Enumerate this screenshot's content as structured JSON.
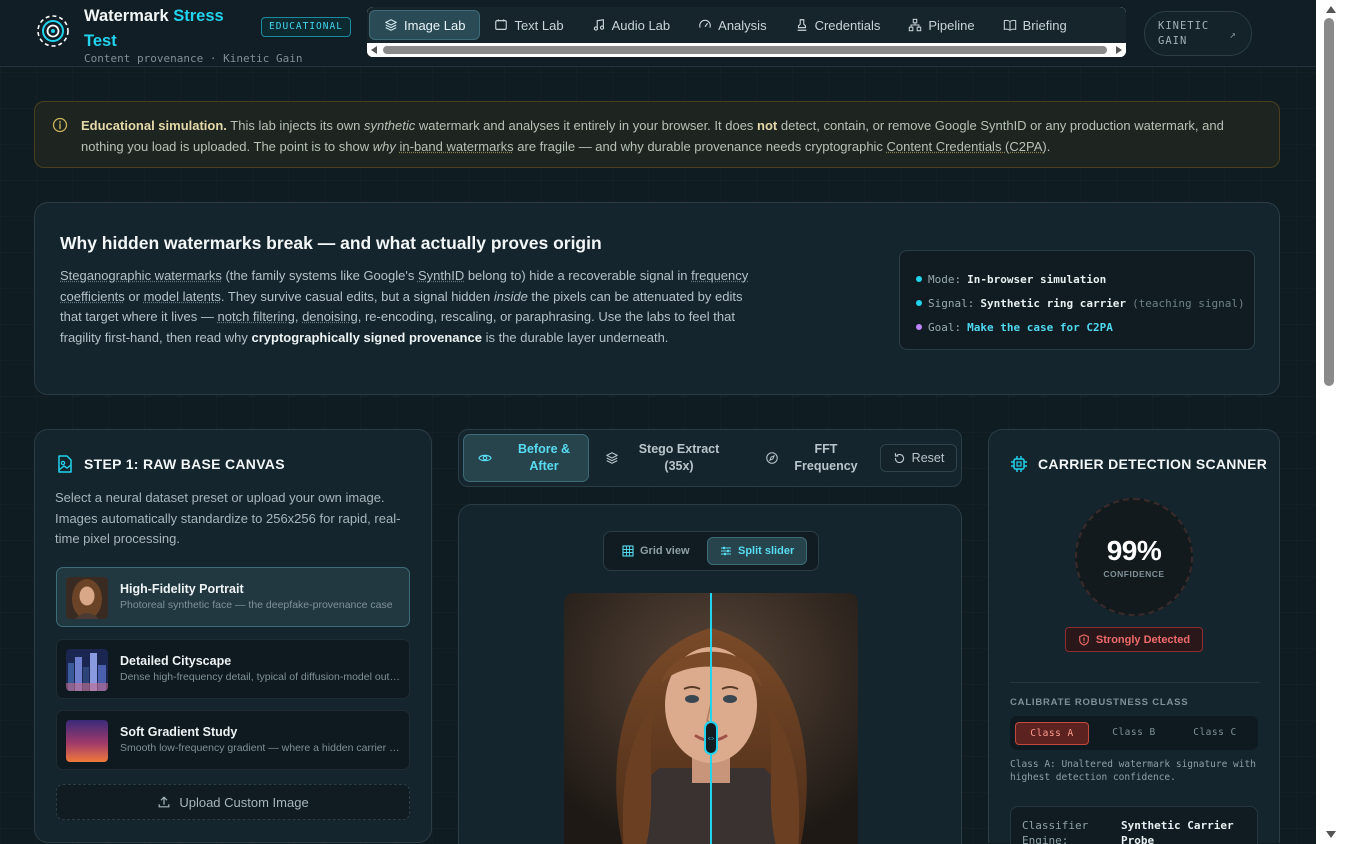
{
  "header": {
    "brand_title_main": "Watermark ",
    "brand_title_accent": "Stress Test",
    "brand_subtitle": "Content provenance · Kinetic Gain",
    "badge": "EDUCATIONAL",
    "nav_tabs": [
      {
        "label": "Image Lab",
        "icon": "image-layers-icon",
        "active": true
      },
      {
        "label": "Text Lab",
        "icon": "text-icon",
        "active": false
      },
      {
        "label": "Audio Lab",
        "icon": "music-note-icon",
        "active": false
      },
      {
        "label": "Analysis",
        "icon": "gauge-icon",
        "active": false
      },
      {
        "label": "Credentials",
        "icon": "stamp-icon",
        "active": false
      },
      {
        "label": "Pipeline",
        "icon": "network-icon",
        "active": false
      },
      {
        "label": "Briefing",
        "icon": "book-icon",
        "active": false
      }
    ],
    "kinetic_link_line1": "KINETIC",
    "kinetic_link_line2": "GAIN",
    "kinetic_link_arrow": "↗"
  },
  "notice": {
    "lead": "Educational simulation.",
    "t1": " This lab injects its own ",
    "em1": "synthetic",
    "t2": " watermark and analyses it entirely in your browser. It does ",
    "strong1": "not",
    "t3": " detect, contain, or remove Google SynthID or any production watermark, and nothing you load is uploaded. The point is to show ",
    "em2": "why",
    "link1": "in-band watermarks",
    "t4": " are fragile — and why durable provenance needs cryptographic ",
    "link2": "Content Credentials (C2PA)",
    "t5": "."
  },
  "why": {
    "title": "Why hidden watermarks break — and what actually proves origin",
    "p_link1": "Steganographic watermarks",
    "p_t1": " (the family systems like Google's ",
    "p_link2": "SynthID",
    "p_t2": " belong to) hide a recoverable signal in ",
    "p_link3": "frequency coefficients",
    "p_t3": " or ",
    "p_link4": "model latents",
    "p_t4": ". They survive casual edits, but a signal hidden ",
    "p_em": "inside",
    "p_t5": " the pixels can be attenuated by edits that target where it lives — ",
    "p_link5": "notch filtering",
    "p_t6": ", ",
    "p_link6": "denoising",
    "p_t7": ", re-encoding, rescaling, or paraphrasing. Use the labs to feel that fragility first-hand, then read why ",
    "p_strong": "cryptographically signed provenance",
    "p_t8": " is the durable layer underneath.",
    "status": [
      {
        "key": "Mode:",
        "value": "In-browser simulation",
        "extra": "",
        "dot_color": "#22d3ee",
        "cyan": false
      },
      {
        "key": "Signal:",
        "value": "Synthetic ring carrier",
        "extra": "(teaching signal)",
        "dot_color": "#22d3ee",
        "cyan": false
      },
      {
        "key": "Goal:",
        "value": "Make the case for C2PA",
        "extra": "",
        "dot_color": "#c084fc",
        "cyan": true
      }
    ]
  },
  "step1": {
    "title": "STEP 1: RAW BASE CANVAS",
    "description": "Select a neural dataset preset or upload your own image. Images automatically standardize to 256x256 for rapid, real-time pixel processing.",
    "presets": [
      {
        "title": "High-Fidelity Portrait",
        "subtitle": "Photoreal synthetic face — the deepfake-provenance case",
        "active": true
      },
      {
        "title": "Detailed Cityscape",
        "subtitle": "Dense high-frequency detail, typical of diffusion-model output",
        "active": false
      },
      {
        "title": "Soft Gradient Study",
        "subtitle": "Smooth low-frequency gradient — where a hidden carrier shows",
        "active": false
      }
    ],
    "upload_label": "Upload Custom Image"
  },
  "modes": {
    "items": [
      {
        "label_line1": "Before &",
        "label_line2": "After",
        "icon": "eye-icon",
        "active": true
      },
      {
        "label_line1": "Stego Extract",
        "label_line2": "(35x)",
        "icon": "layers-icon",
        "active": false
      },
      {
        "label_line1": "FFT",
        "label_line2": "Frequency",
        "icon": "compass-icon",
        "active": false
      }
    ],
    "reset_label": "Reset"
  },
  "preview": {
    "grid_view_label": "Grid view",
    "split_slider_label": "Split slider",
    "split_position": 0.5
  },
  "scanner": {
    "title": "CARRIER DETECTION SCANNER",
    "confidence_value": "99%",
    "confidence_label": "CONFIDENCE",
    "status_label": "Strongly Detected",
    "calibrate_title": "CALIBRATE ROBUSTNESS CLASS",
    "classes": [
      {
        "label": "Class A",
        "active": true
      },
      {
        "label": "Class B",
        "active": false
      },
      {
        "label": "Class C",
        "active": false
      }
    ],
    "class_description": "Class A: Unaltered watermark signature with highest detection confidence.",
    "engine_key": "Classifier Engine:",
    "engine_value": "Synthetic Carrier Probe"
  },
  "colors": {
    "accent": "#22d3ee",
    "danger": "#ef6b6b",
    "background": "#0f1c22"
  }
}
